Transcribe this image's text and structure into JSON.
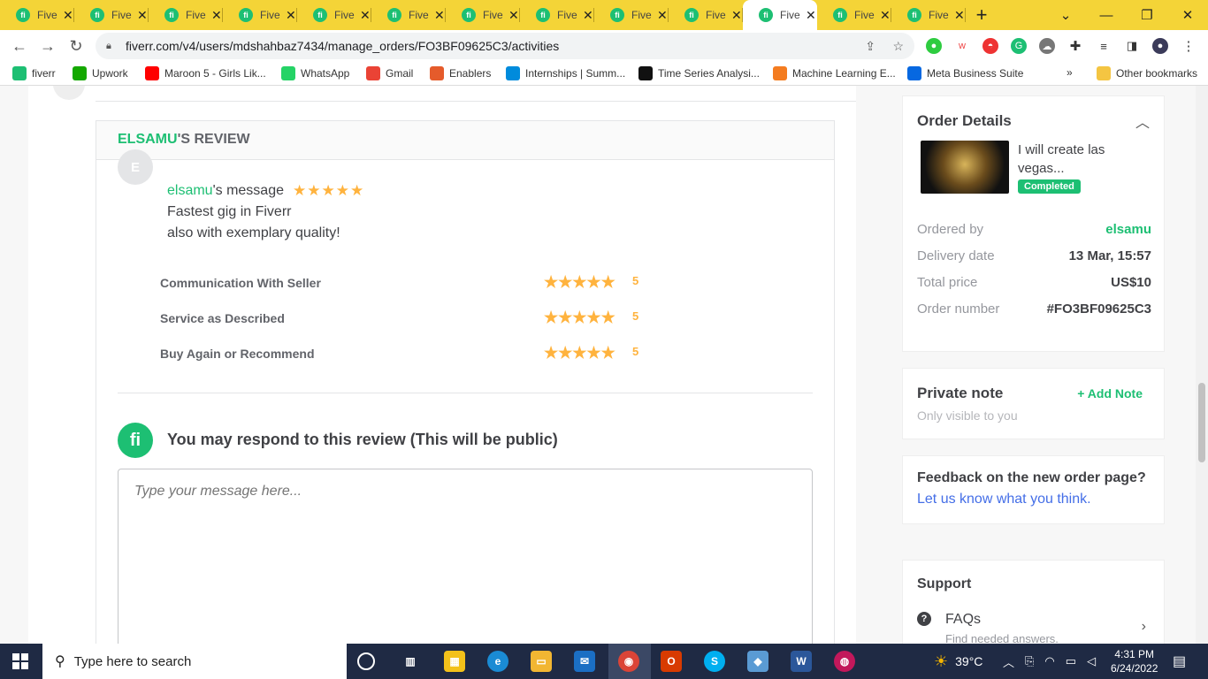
{
  "browser": {
    "tabs": [
      {
        "title": "Five",
        "active": false
      },
      {
        "title": "Five",
        "active": false
      },
      {
        "title": "Five",
        "active": false
      },
      {
        "title": "Five",
        "active": false
      },
      {
        "title": "Five",
        "active": false
      },
      {
        "title": "Five",
        "active": false
      },
      {
        "title": "Five",
        "active": false
      },
      {
        "title": "Five",
        "active": false
      },
      {
        "title": "Five",
        "active": false
      },
      {
        "title": "Five",
        "active": false
      },
      {
        "title": "Five",
        "active": true
      },
      {
        "title": "Five",
        "active": false
      },
      {
        "title": "Five",
        "active": false
      }
    ],
    "new_tab_icon": "plus-icon",
    "url": "fiverr.com/v4/users/mdshahbaz7434/manage_orders/FO3BF09625C3/activities",
    "bookmarks": [
      {
        "label": "fiverr",
        "icon": "fiverr-icon",
        "color": "#1dbf73"
      },
      {
        "label": "Upwork",
        "icon": "upwork-icon",
        "color": "#14a800"
      },
      {
        "label": "Maroon 5 - Girls Lik...",
        "icon": "youtube-icon",
        "color": "#ff0000"
      },
      {
        "label": "WhatsApp",
        "icon": "whatsapp-icon",
        "color": "#25d366"
      },
      {
        "label": "Gmail",
        "icon": "gmail-icon",
        "color": "#ea4335"
      },
      {
        "label": "Enablers",
        "icon": "enablers-icon",
        "color": "#e55b2b"
      },
      {
        "label": "Internships | Summ...",
        "icon": "internshala-icon",
        "color": "#008bdc"
      },
      {
        "label": "Time Series Analysi...",
        "icon": "medium-icon",
        "color": "#111111"
      },
      {
        "label": "Machine Learning E...",
        "icon": "ml-icon",
        "color": "#f47c20"
      },
      {
        "label": "Meta Business Suite",
        "icon": "meta-icon",
        "color": "#0668e1"
      }
    ],
    "more_bookmarks": "»",
    "other_bookmarks": "Other bookmarks"
  },
  "review": {
    "header_user": "ELSAMU",
    "header_suffix": "'S REVIEW",
    "avatar_letter": "E",
    "message_user": "elsamu",
    "message_suffix": "'s message",
    "overall_rating": 5,
    "message_lines": [
      "Fastest gig in Fiverr",
      "also with exemplary quality!"
    ],
    "criteria": [
      {
        "label": "Communication With Seller",
        "rating": 5,
        "value": "5"
      },
      {
        "label": "Service as Described",
        "rating": 5,
        "value": "5"
      },
      {
        "label": "Buy Again or Recommend",
        "rating": 5,
        "value": "5"
      }
    ],
    "respond_title": "You may respond to this review (This will be public)",
    "respond_placeholder": "Type your message here...",
    "logo_letter": "fi"
  },
  "order_details": {
    "title": "Order Details",
    "gig_title": "I will create las vegas...",
    "status": "Completed",
    "rows": [
      {
        "label": "Ordered by",
        "value": "elsamu"
      },
      {
        "label": "Delivery date",
        "value": "13 Mar, 15:57"
      },
      {
        "label": "Total price",
        "value": "US$10"
      },
      {
        "label": "Order number",
        "value": "#FO3BF09625C3"
      }
    ]
  },
  "private_note": {
    "title": "Private note",
    "subtitle": "Only visible to you",
    "action": "+ Add Note"
  },
  "feedback": {
    "title": "Feedback on the new order page?",
    "link": "Let us know what you think."
  },
  "support": {
    "title": "Support",
    "item_title": "FAQs",
    "item_subtitle": "Find needed answers."
  },
  "taskbar": {
    "search_placeholder": "Type here to search",
    "weather": "39°C",
    "time": "4:31 PM",
    "date": "6/24/2022"
  },
  "colors": {
    "accent": "#1dbf73",
    "star": "#ffb33e",
    "tabbar": "#f4d437"
  }
}
